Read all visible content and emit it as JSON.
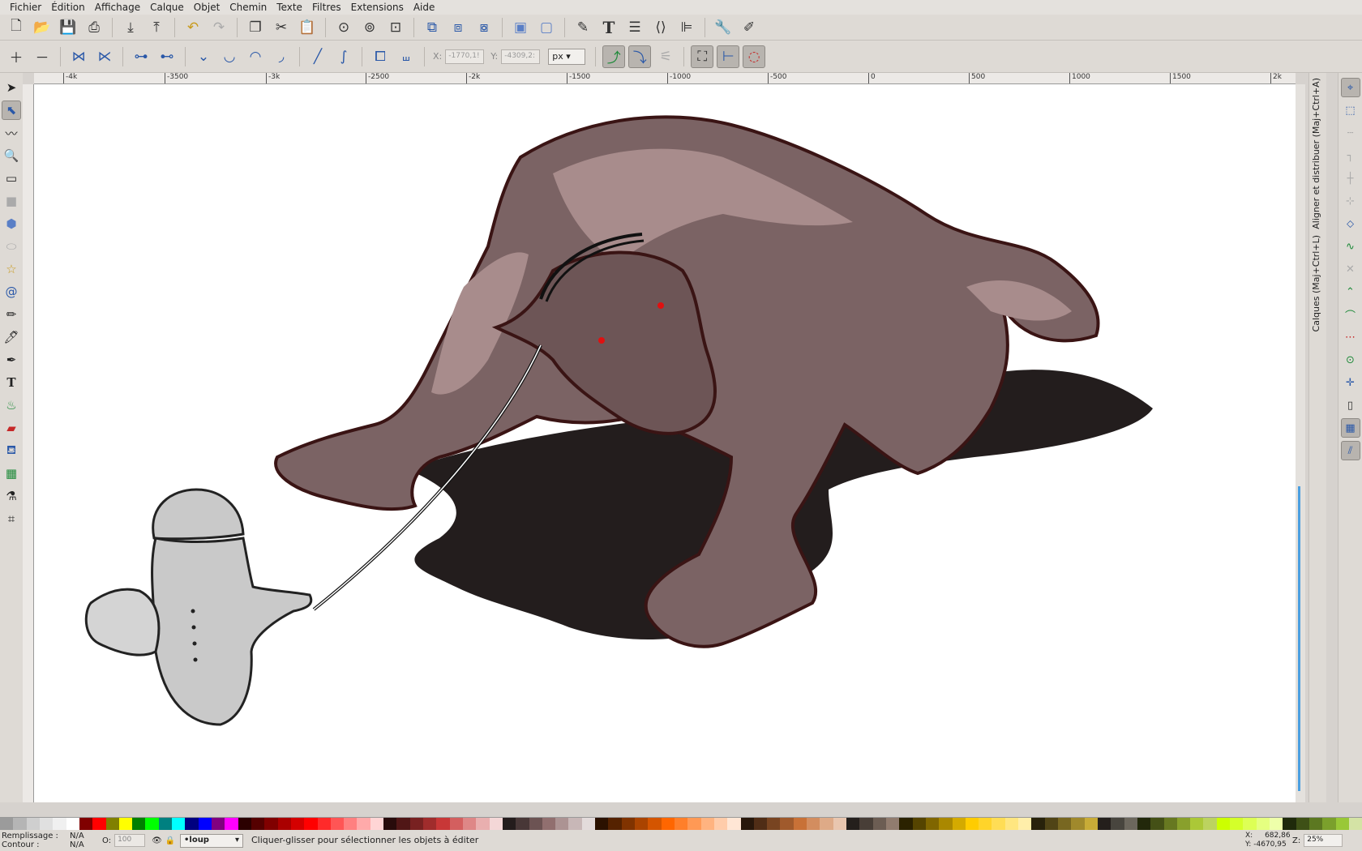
{
  "menu": [
    "Fichier",
    "Édition",
    "Affichage",
    "Calque",
    "Objet",
    "Chemin",
    "Texte",
    "Filtres",
    "Extensions",
    "Aide"
  ],
  "toolbar_top": [
    "new-document-icon",
    "open-icon",
    "save-icon",
    "print-icon",
    "import-icon",
    "export-icon",
    "undo-icon",
    "redo-icon",
    "copy-icon",
    "cut-icon",
    "paste-icon",
    "zoom-selection-icon",
    "zoom-drawing-icon",
    "zoom-page-icon",
    "duplicate-icon",
    "clone-icon",
    "unlink-clone-icon",
    "group-icon",
    "ungroup-icon",
    "fill-stroke-icon",
    "text-icon",
    "layers-icon",
    "xml-editor-icon",
    "align-icon",
    "preferences-icon",
    "document-properties-icon"
  ],
  "node_toolbar": {
    "x_label": "X:",
    "x_value": "-1770,1!",
    "y_label": "Y:",
    "y_value": "-4309,2:",
    "unit": "px"
  },
  "ruler_h": [
    "-4k",
    "-3500",
    "-3k",
    "-2500",
    "-2k",
    "-1500",
    "-1000",
    "-500",
    "0",
    "500",
    "1000",
    "1500",
    "2k"
  ],
  "tools": [
    "selector-tool",
    "node-tool",
    "tweak-tool",
    "zoom-tool",
    "measure-tool",
    "rectangle-tool",
    "3d-box-tool",
    "ellipse-tool",
    "star-tool",
    "spiral-tool",
    "pencil-tool",
    "pen-tool",
    "calligraphy-tool",
    "text-tool",
    "spray-tool",
    "eraser-tool",
    "paint-bucket-tool",
    "gradient-tool",
    "dropper-tool",
    "connector-tool"
  ],
  "dock_tabs": {
    "align": "Aligner et distribuer (Maj+Ctrl+A)",
    "layers": "Calques (Maj+Ctrl+L)"
  },
  "palette": [
    "#9b9b9b",
    "#b5b5b5",
    "#cfcfcf",
    "#e0e0e0",
    "#f0f0f0",
    "#ffffff",
    "#800000",
    "#ff0000",
    "#808000",
    "#ffff00",
    "#008000",
    "#00ff00",
    "#008080",
    "#00ffff",
    "#000080",
    "#0000ff",
    "#800080",
    "#ff00ff",
    "#2b0000",
    "#550000",
    "#800000",
    "#aa0000",
    "#d40000",
    "#ff0000",
    "#ff2a2a",
    "#ff5555",
    "#ff8080",
    "#ffaaaa",
    "#ffd5d5",
    "#280b0b",
    "#501616",
    "#782121",
    "#a02c2c",
    "#c83737",
    "#d35f5f",
    "#de8787",
    "#e9afaf",
    "#f4d7d7",
    "#241c1c",
    "#483737",
    "#6c5353",
    "#916f6f",
    "#ac9393",
    "#c8b7b7",
    "#e3dbdb",
    "#2b1100",
    "#552200",
    "#803300",
    "#aa4400",
    "#d45500",
    "#ff6600",
    "#ff7f2a",
    "#ff9955",
    "#ffb380",
    "#ffccaa",
    "#ffe6d5",
    "#28170b",
    "#502d16",
    "#784421",
    "#a05a2c",
    "#c87137",
    "#d38d5f",
    "#deaa87",
    "#e9c6af",
    "#241f1c",
    "#483e37",
    "#6c5d53",
    "#917c6f",
    "#2b2200",
    "#554400",
    "#806600",
    "#aa8800",
    "#d4aa00",
    "#ffcc00",
    "#ffd42a",
    "#ffdd55",
    "#ffe680",
    "#ffeeaa",
    "#28220b",
    "#504416",
    "#786721",
    "#a0892c",
    "#c8ab37",
    "#241f1c",
    "#48453e",
    "#6c675d",
    "#22280b",
    "#445016",
    "#677821",
    "#89a02c",
    "#abc837",
    "#bcd35f",
    "#ccff00",
    "#d4ff2a",
    "#ddff55",
    "#e5ff80",
    "#eeffaa",
    "#1f2a0b",
    "#3e5016",
    "#5c7821",
    "#7ba02c",
    "#99c837",
    "#d4e3a5"
  ],
  "statusbar": {
    "fill_label": "Remplissage :",
    "fill_value": "N/A",
    "stroke_label": "Contour :",
    "stroke_value": "N/A",
    "opacity_label": "O:",
    "opacity_value": "100",
    "layer": "•loup",
    "message": "Cliquer-glisser pour sélectionner les objets à éditer",
    "x_label": "X:",
    "x_value": "682,86",
    "y_label": "Y:",
    "y_value": "-4670,95",
    "zoom_label": "Z:",
    "zoom_value": "25%"
  }
}
